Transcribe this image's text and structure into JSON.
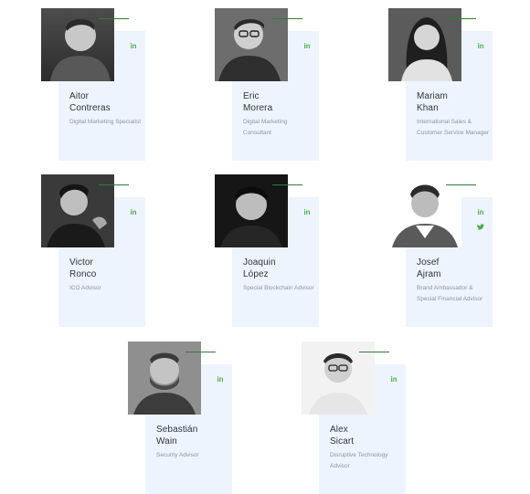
{
  "team": [
    {
      "first": "Aitor",
      "last": "Contreras",
      "role": "Digital Marketing Specialist",
      "social": [
        "in"
      ]
    },
    {
      "first": "Eric",
      "last": "Morera",
      "role": "Digital Marketing Consultant",
      "social": [
        "in"
      ]
    },
    {
      "first": "Mariam",
      "last": "Khan",
      "role": "International Sales & Customer Service Manager",
      "social": [
        "in"
      ]
    },
    {
      "first": "Victor",
      "last": "Ronco",
      "role": "ICO Advisor",
      "social": [
        "in"
      ]
    },
    {
      "first": "Joaquin",
      "last": "López",
      "role": "Special Blockchain Advisor",
      "social": [
        "in"
      ]
    },
    {
      "first": "Josef",
      "last": "Ajram",
      "role": "Brand Ambassador & Special Financial Advisor",
      "social": [
        "in",
        "t"
      ]
    },
    {
      "first": "Sebastián",
      "last": "Wain",
      "role": "Security Advisor",
      "social": [
        "in"
      ]
    },
    {
      "first": "Alex",
      "last": "Sicart",
      "role": "Disruptive Technology Advisor",
      "social": [
        "in"
      ]
    }
  ],
  "colors": {
    "accent": "#2e7d32",
    "social": "#4caf50",
    "panel": "#eef4fd",
    "name": "#2d3640",
    "role": "#8a95a3"
  },
  "icons": {
    "linkedin": "linkedin-icon",
    "twitter": "twitter-icon"
  }
}
